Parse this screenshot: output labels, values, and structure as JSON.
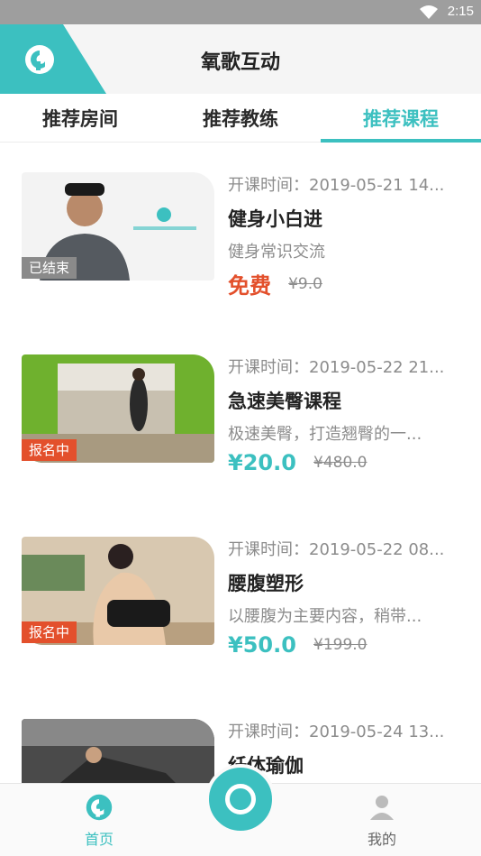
{
  "status_bar": {
    "time": "2:15"
  },
  "header": {
    "title": "氧歌互动"
  },
  "tabs": [
    {
      "label": "推荐房间",
      "active": false
    },
    {
      "label": "推荐教练",
      "active": false
    },
    {
      "label": "推荐课程",
      "active": true
    }
  ],
  "courses": [
    {
      "time": "开课时间：2019-05-21 14...",
      "name": "健身小白进",
      "desc": "健身常识交流",
      "price": "免费",
      "original_price": "¥9.0",
      "status": "已结束"
    },
    {
      "time": "开课时间：2019-05-22 21...",
      "name": "急速美臀课程",
      "desc": "极速美臀，打造翘臀的一...",
      "price": "¥20.0",
      "original_price": "¥480.0",
      "status": "报名中"
    },
    {
      "time": "开课时间：2019-05-22 08...",
      "name": "腰腹塑形",
      "desc": "以腰腹为主要内容，稍带...",
      "price": "¥50.0",
      "original_price": "¥199.0",
      "status": "报名中"
    },
    {
      "time": "开课时间：2019-05-24 13...",
      "name": "纤体瑜伽",
      "desc": "",
      "price": "",
      "original_price": "",
      "status": ""
    }
  ],
  "bottom_nav": {
    "home_label": "首页",
    "me_label": "我的"
  },
  "colors": {
    "accent": "#3cc0c0",
    "free": "#e3502c",
    "ended_badge": "#8a8a8a",
    "open_badge": "#e3502c"
  }
}
